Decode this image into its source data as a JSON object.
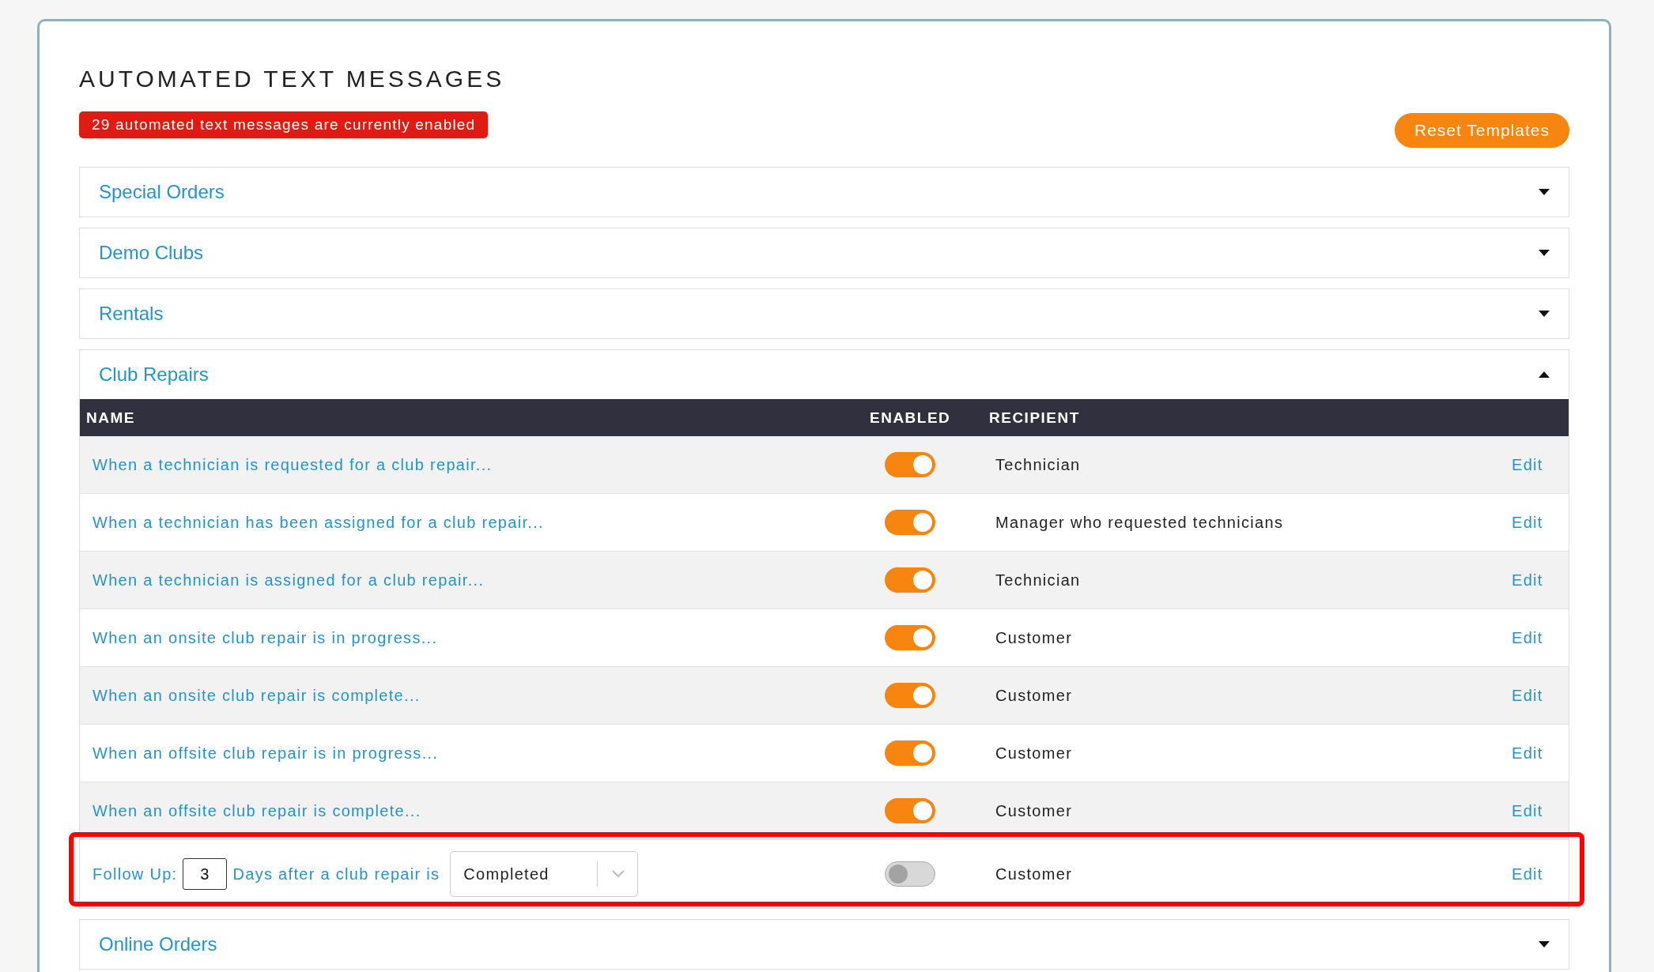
{
  "title": "AUTOMATED TEXT MESSAGES",
  "badge": "29 automated text messages are currently enabled",
  "reset_button": "Reset Templates",
  "sections": [
    {
      "title": "Special Orders",
      "expanded": false
    },
    {
      "title": "Demo Clubs",
      "expanded": false
    },
    {
      "title": "Rentals",
      "expanded": false
    },
    {
      "title": "Club Repairs",
      "expanded": true,
      "table": {
        "columns": [
          "NAME",
          "ENABLED",
          "RECIPIENT"
        ],
        "rows": [
          {
            "name": "When a technician is requested for a club repair...",
            "enabled": true,
            "recipient": "Technician",
            "action": "Edit"
          },
          {
            "name": "When a technician has been assigned for a club repair...",
            "enabled": true,
            "recipient": "Manager who requested technicians",
            "action": "Edit"
          },
          {
            "name": "When a technician is assigned for a club repair...",
            "enabled": true,
            "recipient": "Technician",
            "action": "Edit"
          },
          {
            "name": "When an onsite club repair is in progress...",
            "enabled": true,
            "recipient": "Customer",
            "action": "Edit"
          },
          {
            "name": "When an onsite club repair is complete...",
            "enabled": true,
            "recipient": "Customer",
            "action": "Edit"
          },
          {
            "name": "When an offsite club repair is in progress...",
            "enabled": true,
            "recipient": "Customer",
            "action": "Edit"
          },
          {
            "name": "When an offsite club repair is complete...",
            "enabled": true,
            "recipient": "Customer",
            "action": "Edit"
          }
        ],
        "follow_up": {
          "label": "Follow Up:",
          "days": "3",
          "text": "Days after a club repair is",
          "status": "Completed",
          "enabled": false,
          "recipient": "Customer",
          "action": "Edit",
          "highlighted": true
        }
      }
    },
    {
      "title": "Online Orders",
      "expanded": false
    }
  ]
}
